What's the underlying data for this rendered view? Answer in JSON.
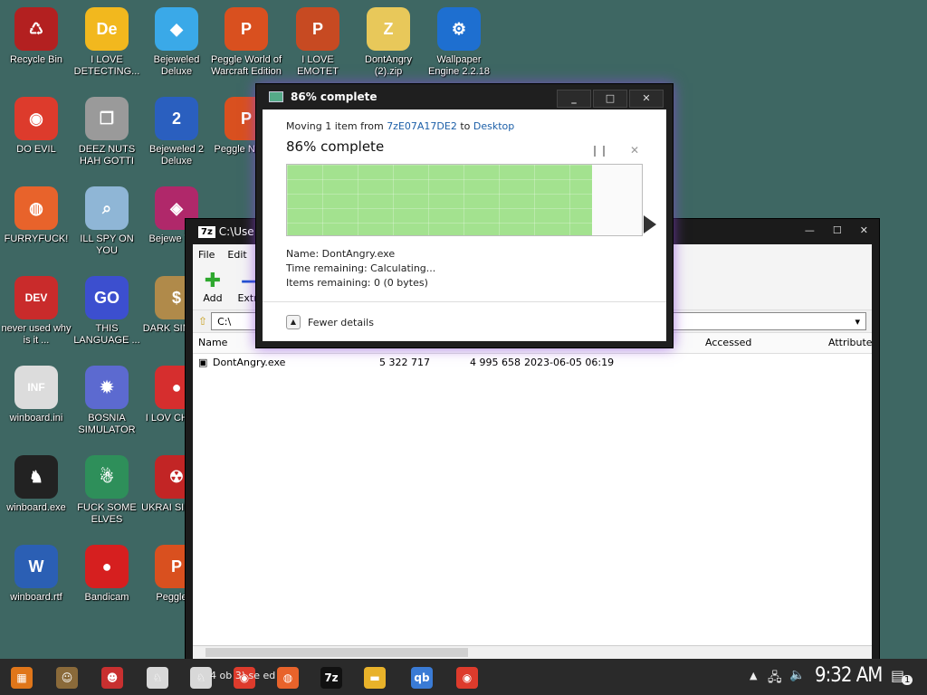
{
  "desktop": {
    "icons": [
      {
        "label": "Recycle Bin",
        "icon": "recycle-bin-icon",
        "color": "#b32020",
        "glyph": "♺"
      },
      {
        "label": "I LOVE DETECTING...",
        "icon": "de-app-icon",
        "color": "#f2b81e",
        "glyph": "De"
      },
      {
        "label": "Bejeweled Deluxe",
        "icon": "gem-icon",
        "color": "#3aa9e8",
        "glyph": "◆"
      },
      {
        "label": "Peggle World of Warcraft Edition",
        "icon": "peggle-icon",
        "color": "#d9501f",
        "glyph": "P"
      },
      {
        "label": "I LOVE EMOTET",
        "icon": "powerpoint-icon",
        "color": "#c74a22",
        "glyph": "P"
      },
      {
        "label": "DontAngry (2).zip",
        "icon": "zip-folder-icon",
        "color": "#e8c85a",
        "glyph": "Z"
      },
      {
        "label": "Wallpaper Engine 2.2.18",
        "icon": "wallpaper-engine-icon",
        "color": "#1e6fd0",
        "glyph": "⚙"
      },
      {
        "label": "DO EVIL",
        "icon": "chrome-icon",
        "color": "#dd3b2c",
        "glyph": "◉"
      },
      {
        "label": "DEEZ NUTS HAH GOTTI",
        "icon": "stacked-windows-icon",
        "color": "#9a9a9a",
        "glyph": "❐"
      },
      {
        "label": "Bejeweled 2 Deluxe",
        "icon": "bejeweled2-icon",
        "color": "#2a5fbf",
        "glyph": "2"
      },
      {
        "label": "Peggle N Delu",
        "icon": "peggle-nights-icon",
        "color": "#d9501f",
        "glyph": "P"
      },
      {
        "label": "FURRYFUCK!",
        "icon": "firefox-icon",
        "color": "#e8632b",
        "glyph": "◍"
      },
      {
        "label": "ILL SPY ON YOU",
        "icon": "network-spy-icon",
        "color": "#8fb6d6",
        "glyph": "⌕"
      },
      {
        "label": "Bejewe Twis",
        "icon": "bejeweled-twist-icon",
        "color": "#b0286a",
        "glyph": "◈"
      },
      {
        "label": "never used why is it ...",
        "icon": "devcpp-icon",
        "color": "#c92b2b",
        "glyph": "DEV"
      },
      {
        "label": "THIS LANGUAGE ...",
        "icon": "goland-icon",
        "color": "#3c4fcf",
        "glyph": "GO"
      },
      {
        "label": "DARK SIMULA",
        "icon": "money-bag-icon",
        "color": "#b08a4a",
        "glyph": "$"
      },
      {
        "label": "winboard.ini",
        "icon": "ini-file-icon",
        "color": "#dcdcdc",
        "glyph": "INF"
      },
      {
        "label": "BOSNIA SIMULATOR",
        "icon": "spiked-ball-icon",
        "color": "#5c6ad0",
        "glyph": "✹"
      },
      {
        "label": "I LOV CHUZZ",
        "icon": "chuzzle-icon",
        "color": "#d62e2e",
        "glyph": "●"
      },
      {
        "label": "winboard.exe",
        "icon": "chess-knight-icon",
        "color": "#222222",
        "glyph": "♞"
      },
      {
        "label": "FUCK SOME ELVES",
        "icon": "santa-icon",
        "color": "#2e8f5a",
        "glyph": "☃"
      },
      {
        "label": "UKRAI SIMULA",
        "icon": "radiation-icon",
        "color": "#c22525",
        "glyph": "☢"
      },
      {
        "label": "winboard.rtf",
        "icon": "word-doc-icon",
        "color": "#2b5fb4",
        "glyph": "W"
      },
      {
        "label": "Bandicam",
        "icon": "bandicam-icon",
        "color": "#d61f1f",
        "glyph": "●"
      },
      {
        "label": "Peggle D",
        "icon": "peggle-deluxe-icon",
        "color": "#d9501f",
        "glyph": "P"
      }
    ]
  },
  "zip_window": {
    "title": "C:\\Use",
    "menu": [
      "File",
      "Edit"
    ],
    "tools": [
      {
        "label": "Add",
        "glyph": "✚",
        "color": "#2ea82e"
      },
      {
        "label": "Extra",
        "glyph": "—",
        "color": "#1f4fd0"
      }
    ],
    "path": "C:\\",
    "columns": [
      "Name",
      "Accessed",
      "Attribute"
    ],
    "files": [
      {
        "name": "DontAngry.exe",
        "size": "5 322 717",
        "packed": "4 995 658",
        "modified": "2023-06-05 06:19"
      }
    ]
  },
  "progress_dialog": {
    "title": "86% complete",
    "moving_prefix": "Moving 1 item from ",
    "source": "7zE07A17DE2",
    "to_word": " to ",
    "destination": "Desktop",
    "heading": "86% complete",
    "percent": 86,
    "name_line": "Name:  DontAngry.exe",
    "time_line": "Time remaining:  Calculating...",
    "items_line": "Items remaining:  0 (0 bytes)",
    "fewer_details": "Fewer details",
    "fill_color": "#a3e28f"
  },
  "taskbar": {
    "pinned": [
      {
        "icon": "start-flag-icon",
        "glyph": "▦",
        "color": "#e0761a"
      },
      {
        "icon": "game-character-icon",
        "glyph": "☺",
        "color": "#8a6a3a"
      },
      {
        "icon": "red-face-icon",
        "glyph": "☻",
        "color": "#c83030"
      },
      {
        "icon": "dog-icon",
        "glyph": "♘",
        "color": "#d8d8d8"
      },
      {
        "icon": "dog-icon-2",
        "glyph": "♘",
        "color": "#d8d8d8"
      },
      {
        "icon": "chrome-icon",
        "glyph": "◉",
        "color": "#dd3b2c"
      },
      {
        "icon": "firefox-icon",
        "glyph": "◍",
        "color": "#e8632b"
      },
      {
        "icon": "7zip-icon",
        "glyph": "7z",
        "color": "#111111"
      },
      {
        "icon": "file-explorer-icon",
        "glyph": "▬",
        "color": "#e8b22a"
      },
      {
        "icon": "qbittorrent-icon",
        "glyph": "qb",
        "color": "#3a7bd5"
      },
      {
        "icon": "chrome-icon-2",
        "glyph": "◉",
        "color": "#dd3b2c"
      }
    ],
    "overlap_text": "4 ob   3) se   ed",
    "clock": "9:32 AM",
    "notification_count": "1"
  }
}
